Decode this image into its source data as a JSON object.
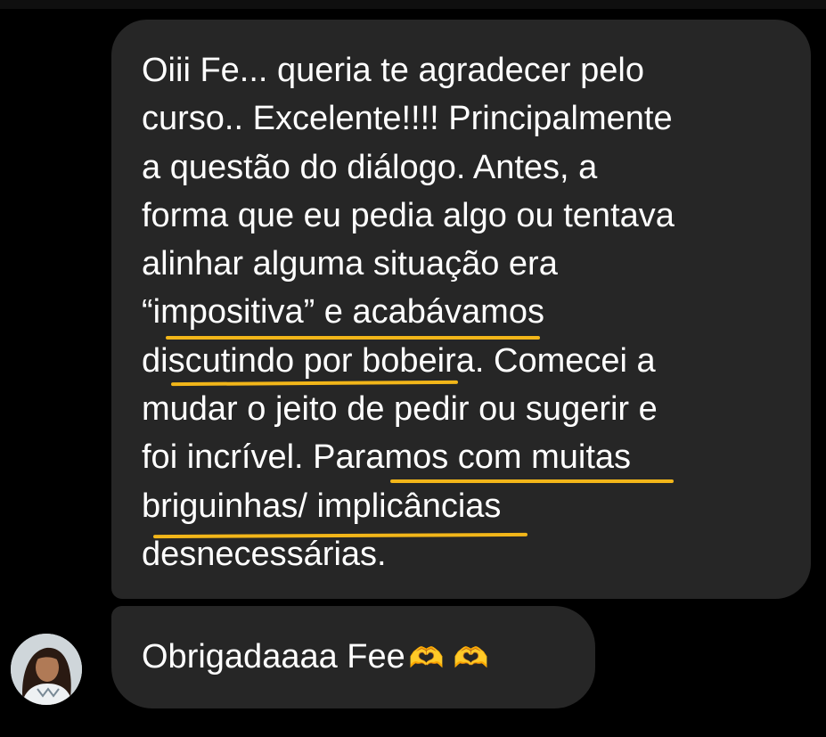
{
  "chat": {
    "message_lines": [
      "Oiii Fe... queria te agradecer pelo",
      "curso.. Excelente!!!! Principalmente",
      "a questão do diálogo. Antes, a",
      "forma que eu pedia algo ou tentava",
      "alinhar alguma situação era",
      "“impositiva” e acabávamos",
      "discutindo por bobeira. Comecei a",
      "mudar o jeito de pedir ou sugerir e",
      "foi incrível. Paramos com muitas",
      "briguinhas/ implicâncias",
      "desnecessárias."
    ],
    "second_message": "Obrigadaaaa Fee",
    "second_message_emoji": "🫶 🫶",
    "highlight_color": "#f2b619",
    "bubble_color": "#262626",
    "background_color": "#000000"
  }
}
